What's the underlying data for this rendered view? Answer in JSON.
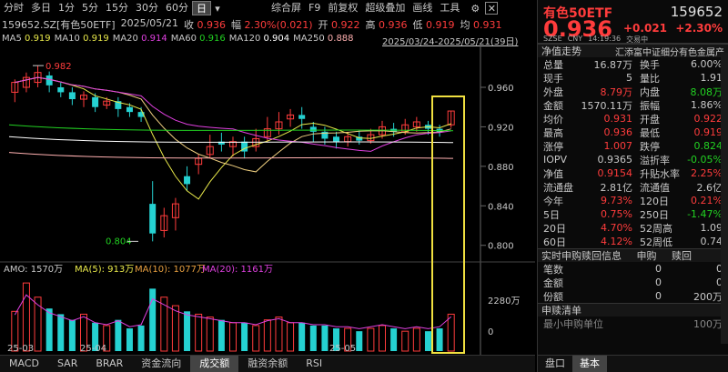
{
  "toolbar": {
    "periods": [
      "分时",
      "多日",
      "1分",
      "5分",
      "15分",
      "30分",
      "60分",
      "日"
    ],
    "active": "日",
    "actions": [
      "综合屏",
      "F9",
      "前复权",
      "超级叠加",
      "画线",
      "工具"
    ]
  },
  "quote": {
    "code": "159652.SZ[有色50ETF]",
    "date": "2025/05/21",
    "close_label": "收",
    "close": "0.936",
    "chg_label": "幅",
    "chg": "2.30%(0.021)",
    "open_label": "开",
    "open": "0.922",
    "high_label": "高",
    "high": "0.936",
    "low_label": "低",
    "low": "0.919",
    "last_label": "均",
    "last": "0.931"
  },
  "ma": {
    "ma5": "MA5",
    "ma5_v": "0.919",
    "ma10": "MA10",
    "ma10_v": "0.919",
    "ma20": "MA20",
    "ma20_v": "0.914",
    "ma60": "MA60",
    "ma60_v": "0.916",
    "ma120": "MA120",
    "ma120_v": "0.904",
    "ma250": "MA250",
    "ma250_v": "0.888",
    "range": "2025/03/24-2025/05/21(39日)"
  },
  "price_axis": [
    "0.960",
    "0.920",
    "0.880",
    "0.840",
    "0.800"
  ],
  "annot": {
    "high": "0.982",
    "low": "0.804"
  },
  "volume": {
    "amo_label": "AMO: 1570万",
    "ma5": "MA(5): 913万",
    "ma10": "MA(10): 1077万",
    "ma20": "MA(20): 1161万",
    "axis_top": "2280万",
    "axis_zero": "0"
  },
  "dates": [
    "25-03",
    "25-04",
    "25-05"
  ],
  "bottom_tabs": [
    "MACD",
    "SAR",
    "BRAR",
    "资金流向",
    "成交额",
    "融资余额",
    "RSI"
  ],
  "bottom_active": "成交额",
  "candles": [
    {
      "o": 0.955,
      "c": 0.965,
      "h": 0.968,
      "l": 0.945
    },
    {
      "o": 0.96,
      "c": 0.97,
      "h": 0.975,
      "l": 0.955
    },
    {
      "o": 0.965,
      "c": 0.975,
      "h": 0.982,
      "l": 0.96
    },
    {
      "o": 0.972,
      "c": 0.962,
      "h": 0.976,
      "l": 0.955
    },
    {
      "o": 0.96,
      "c": 0.955,
      "h": 0.965,
      "l": 0.95
    },
    {
      "o": 0.955,
      "c": 0.948,
      "h": 0.96,
      "l": 0.942
    },
    {
      "o": 0.948,
      "c": 0.952,
      "h": 0.956,
      "l": 0.94
    },
    {
      "o": 0.95,
      "c": 0.94,
      "h": 0.954,
      "l": 0.935
    },
    {
      "o": 0.942,
      "c": 0.946,
      "h": 0.95,
      "l": 0.938
    },
    {
      "o": 0.946,
      "c": 0.938,
      "h": 0.95,
      "l": 0.93
    },
    {
      "o": 0.94,
      "c": 0.935,
      "h": 0.944,
      "l": 0.93
    },
    {
      "o": 0.935,
      "c": 0.93,
      "h": 0.94,
      "l": 0.925
    },
    {
      "o": 0.842,
      "c": 0.812,
      "h": 0.865,
      "l": 0.804
    },
    {
      "o": 0.815,
      "c": 0.83,
      "h": 0.838,
      "l": 0.808
    },
    {
      "o": 0.828,
      "c": 0.842,
      "h": 0.848,
      "l": 0.815
    },
    {
      "o": 0.87,
      "c": 0.862,
      "h": 0.88,
      "l": 0.855
    },
    {
      "o": 0.882,
      "c": 0.888,
      "h": 0.892,
      "l": 0.872
    },
    {
      "o": 0.892,
      "c": 0.9,
      "h": 0.912,
      "l": 0.888
    },
    {
      "o": 0.905,
      "c": 0.902,
      "h": 0.914,
      "l": 0.895
    },
    {
      "o": 0.9,
      "c": 0.905,
      "h": 0.91,
      "l": 0.89
    },
    {
      "o": 0.905,
      "c": 0.895,
      "h": 0.91,
      "l": 0.888
    },
    {
      "o": 0.9,
      "c": 0.908,
      "h": 0.918,
      "l": 0.895
    },
    {
      "o": 0.91,
      "c": 0.918,
      "h": 0.93,
      "l": 0.905
    },
    {
      "o": 0.918,
      "c": 0.925,
      "h": 0.935,
      "l": 0.912
    },
    {
      "o": 0.928,
      "c": 0.932,
      "h": 0.938,
      "l": 0.92
    },
    {
      "o": 0.932,
      "c": 0.928,
      "h": 0.94,
      "l": 0.918
    },
    {
      "o": 0.92,
      "c": 0.915,
      "h": 0.925,
      "l": 0.905
    },
    {
      "o": 0.915,
      "c": 0.908,
      "h": 0.92,
      "l": 0.902
    },
    {
      "o": 0.91,
      "c": 0.905,
      "h": 0.915,
      "l": 0.898
    },
    {
      "o": 0.905,
      "c": 0.91,
      "h": 0.915,
      "l": 0.9
    },
    {
      "o": 0.91,
      "c": 0.906,
      "h": 0.916,
      "l": 0.902
    },
    {
      "o": 0.906,
      "c": 0.912,
      "h": 0.918,
      "l": 0.903
    },
    {
      "o": 0.912,
      "c": 0.92,
      "h": 0.926,
      "l": 0.908
    },
    {
      "o": 0.918,
      "c": 0.915,
      "h": 0.924,
      "l": 0.91
    },
    {
      "o": 0.915,
      "c": 0.922,
      "h": 0.928,
      "l": 0.912
    },
    {
      "o": 0.92,
      "c": 0.925,
      "h": 0.93,
      "l": 0.915
    },
    {
      "o": 0.922,
      "c": 0.918,
      "h": 0.926,
      "l": 0.912
    },
    {
      "o": 0.918,
      "c": 0.915,
      "h": 0.922,
      "l": 0.91
    },
    {
      "o": 0.922,
      "c": 0.936,
      "h": 0.936,
      "l": 0.919
    }
  ],
  "vols": [
    14,
    24,
    19,
    15,
    13,
    11,
    13,
    10,
    9,
    11,
    8,
    9,
    22,
    19,
    16,
    14,
    13,
    12,
    11,
    10,
    10,
    9,
    11,
    12,
    10,
    10,
    9,
    9,
    8,
    8,
    7,
    8,
    9,
    8,
    7,
    8,
    7,
    8,
    13
  ],
  "right": {
    "name": "有色50ETF",
    "code": "159652",
    "price": "0.936",
    "chg": "+0.021",
    "pct": "+2.30%",
    "sub": [
      "SZSE",
      "CNY",
      "14:19:36",
      "交易中"
    ],
    "tabs": [
      "净值走势",
      "汇添富中证细分有色金属产"
    ],
    "rows": [
      {
        "k": "总量",
        "v": "16.87万",
        "vc": "",
        "k2": "换手",
        "v2": "6.00%",
        "v2c": ""
      },
      {
        "k": "现手",
        "v": "5",
        "vc": "",
        "k2": "量比",
        "v2": "1.91",
        "v2c": ""
      },
      {
        "k": "外盘",
        "v": "8.79万",
        "vc": "red",
        "k2": "内盘",
        "v2": "8.08万",
        "v2c": "green"
      },
      {
        "k": "金额",
        "v": "1570.11万",
        "vc": "",
        "k2": "振幅",
        "v2": "1.86%",
        "v2c": ""
      },
      {
        "k": "均价",
        "v": "0.931",
        "vc": "red",
        "k2": "开盘",
        "v2": "0.922",
        "v2c": "red"
      },
      {
        "k": "最高",
        "v": "0.936",
        "vc": "red",
        "k2": "最低",
        "v2": "0.919",
        "v2c": "red"
      },
      {
        "k": "涨停",
        "v": "1.007",
        "vc": "red",
        "k2": "跌停",
        "v2": "0.824",
        "v2c": "green"
      },
      {
        "k": "IOPV",
        "v": "0.9365",
        "vc": "",
        "k2": "溢折率",
        "v2": "-0.05%",
        "v2c": "green"
      },
      {
        "k": "净值",
        "v": "0.9154",
        "vc": "red",
        "k2": "升贴水率",
        "v2": "2.25%",
        "v2c": "red"
      },
      {
        "k": "流通盘",
        "v": "2.81亿",
        "vc": "",
        "k2": "流通值",
        "v2": "2.6亿",
        "v2c": ""
      },
      {
        "k": "今年",
        "v": "9.73%",
        "vc": "red",
        "k2": "120日",
        "v2": "0.21%",
        "v2c": "red"
      },
      {
        "k": "5日",
        "v": "0.75%",
        "vc": "red",
        "k2": "250日",
        "v2": "-1.47%",
        "v2c": "green"
      },
      {
        "k": "20日",
        "v": "4.70%",
        "vc": "red",
        "k2": "52周高",
        "v2": "1.09",
        "v2c": ""
      },
      {
        "k": "60日",
        "v": "4.12%",
        "vc": "red",
        "k2": "52周低",
        "v2": "0.74",
        "v2c": ""
      }
    ],
    "sg_title": "实时申购赎回信息",
    "sg_cols": [
      "申购",
      "赎回"
    ],
    "sg_rows": [
      {
        "k": "笔数",
        "a": "0",
        "b": "0"
      },
      {
        "k": "金额",
        "a": "0",
        "b": "0"
      },
      {
        "k": "份额",
        "a": "0",
        "b": "200万"
      }
    ],
    "list_title": "申赎清单",
    "list_row": "最小申购单位",
    "list_val": "100万",
    "bottom_tabs": [
      "盘口",
      "基本"
    ],
    "bottom_active": "基本"
  }
}
